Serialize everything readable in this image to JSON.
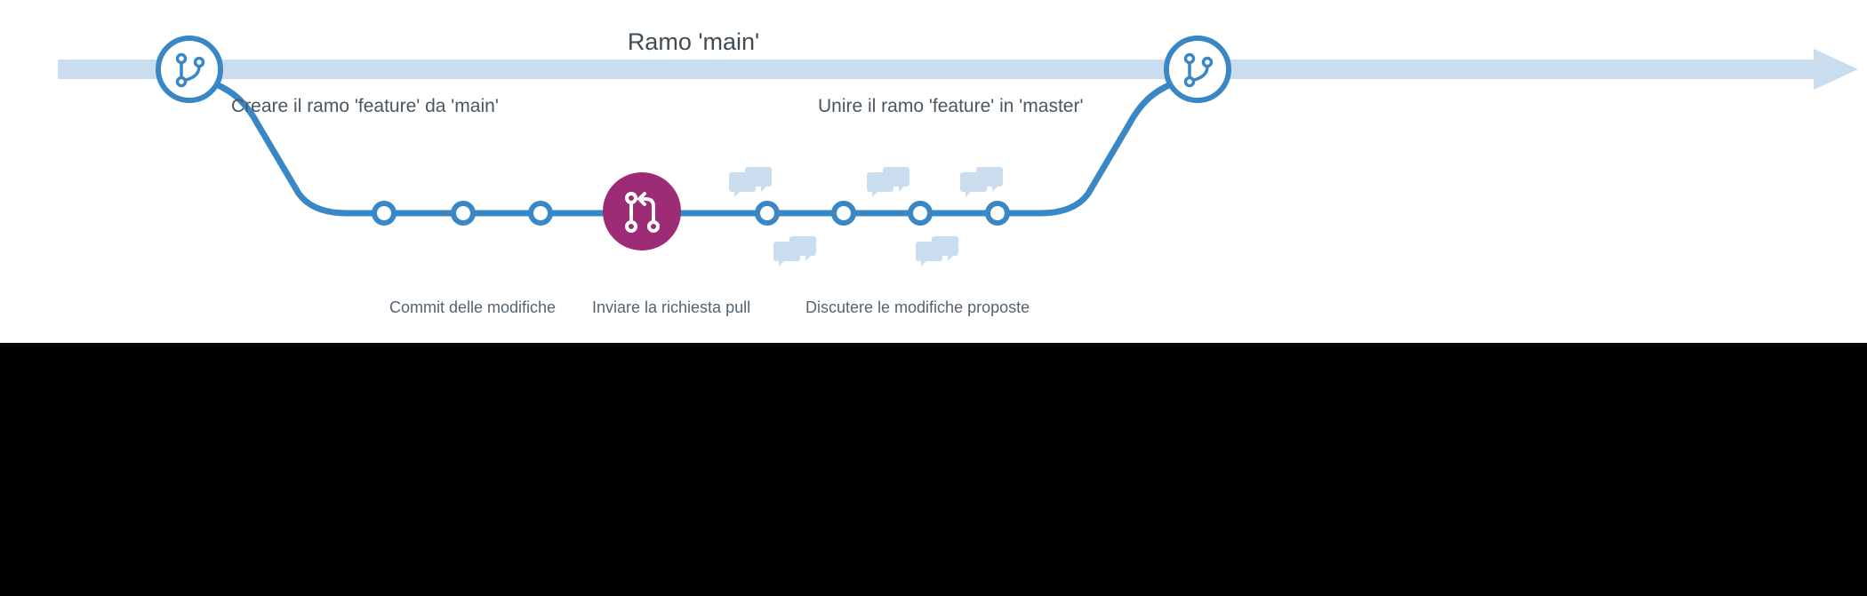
{
  "labels": {
    "main_branch": "Ramo 'main'",
    "create_branch": "Creare il ramo 'feature' da 'main'",
    "merge_branch": "Unire il ramo 'feature' in 'master'"
  },
  "captions": {
    "commit": "Commit delle modifiche",
    "send_pr": "Inviare la richiesta pull",
    "discuss": "Discutere le modifiche proposte"
  },
  "colors": {
    "blue": "#3a87c6",
    "light_blue": "#c9ddef",
    "purple": "#9d2b76",
    "bubble": "#c9ddef"
  }
}
